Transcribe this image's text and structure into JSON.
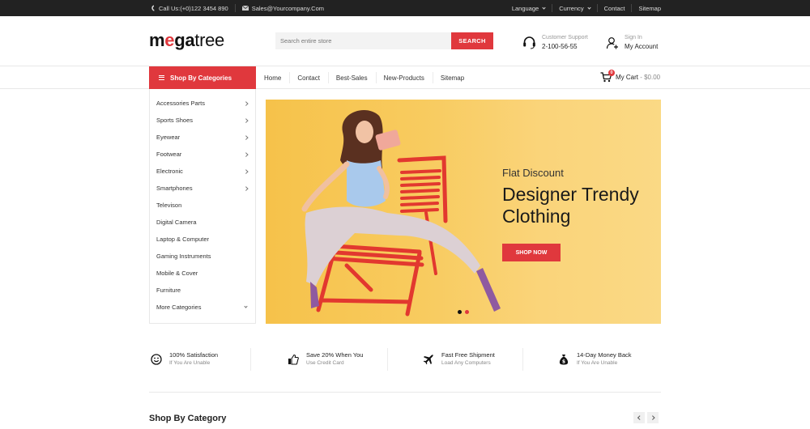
{
  "topbar": {
    "phone": "Call Us:(+0)122 3454 890",
    "email": "Sales@Yourcompany.Com",
    "links": [
      {
        "label": "Language",
        "dropdown": true
      },
      {
        "label": "Currency",
        "dropdown": true
      },
      {
        "label": "Contact",
        "dropdown": false
      },
      {
        "label": "Sitemap",
        "dropdown": false
      }
    ]
  },
  "header": {
    "logo": {
      "part1": "m",
      "part2": "e",
      "part3": "ga",
      "part4": "tree"
    },
    "search": {
      "placeholder": "Search entire store",
      "value": "",
      "button": "SEARCH"
    },
    "support": {
      "label": "Customer Support",
      "phone": "2-100-56-55"
    },
    "account": {
      "label": "Sign In",
      "link": "My Account"
    }
  },
  "nav": {
    "categories_button": "Shop By Categories",
    "menu": [
      "Home",
      "Contact",
      "Best-Sales",
      "New-Products",
      "Sitemap"
    ],
    "cart": {
      "label": "My Cart",
      "separator": " - ",
      "total": "$0.00",
      "count": "0"
    }
  },
  "sidebar": {
    "categories": [
      {
        "label": "Accessories Parts",
        "has_sub": true
      },
      {
        "label": "Sports Shoes",
        "has_sub": true
      },
      {
        "label": "Eyewear",
        "has_sub": true
      },
      {
        "label": "Footwear",
        "has_sub": true
      },
      {
        "label": "Electronic",
        "has_sub": true
      },
      {
        "label": "Smartphones",
        "has_sub": true
      },
      {
        "label": "Televison",
        "has_sub": false
      },
      {
        "label": "Digital Camera",
        "has_sub": false
      },
      {
        "label": "Laptop & Computer",
        "has_sub": false
      },
      {
        "label": "Gaming Instruments",
        "has_sub": false
      },
      {
        "label": "Mobile & Cover",
        "has_sub": false
      },
      {
        "label": "Furniture",
        "has_sub": false
      }
    ],
    "more": "More Categories"
  },
  "banner": {
    "subtitle": "Flat Discount",
    "title_line1": "Designer Trendy",
    "title_line2": "Clothing",
    "button": "SHOP NOW",
    "slides": 2,
    "active_slide": 2
  },
  "features": [
    {
      "icon": "smiley-icon",
      "title": "100% Satisfaction",
      "subtitle": "If You Are Unable"
    },
    {
      "icon": "thumbs-up-icon",
      "title": "Save 20% When You",
      "subtitle": "Use Credit Card"
    },
    {
      "icon": "airplane-icon",
      "title": "Fast Free Shipment",
      "subtitle": "Load Any Computers"
    },
    {
      "icon": "money-bag-icon",
      "title": "14-Day Money Back",
      "subtitle": "If You Are Unable"
    }
  ],
  "section": {
    "title": "Shop By Category"
  },
  "colors": {
    "accent": "#e0383d",
    "topbar": "#222222",
    "banner": "#f8cb5f"
  }
}
